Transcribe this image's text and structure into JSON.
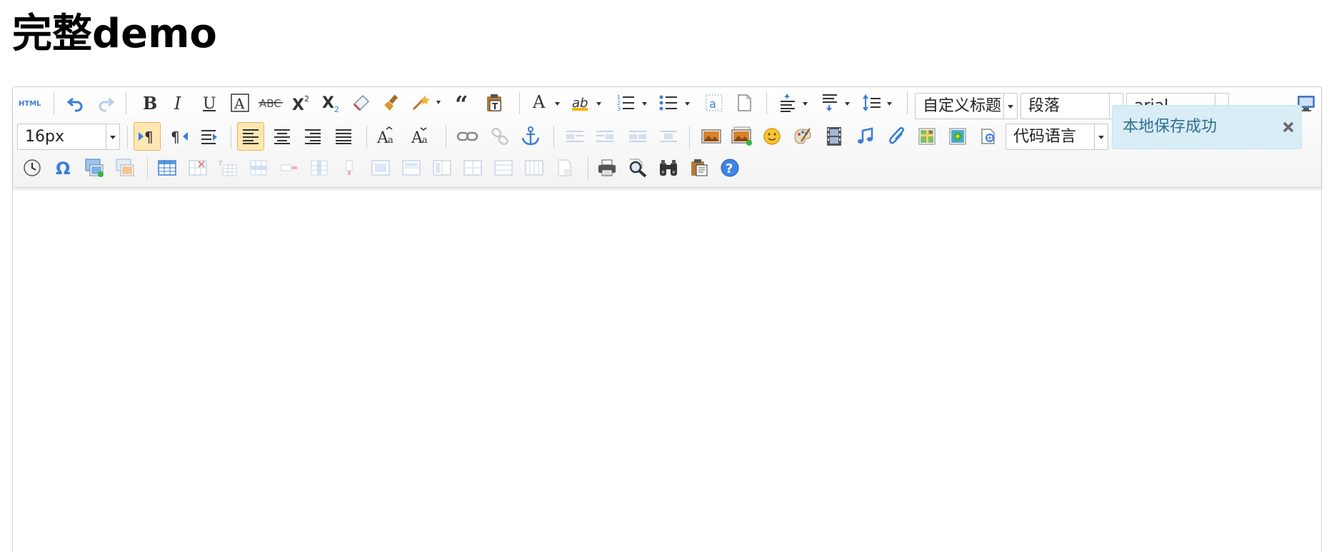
{
  "page": {
    "title": "完整demo"
  },
  "toolbar": {
    "font_size": "16px",
    "custom_heading": "自定义标题",
    "paragraph": "段落",
    "font_family": "arial",
    "code_language": "代码语言"
  },
  "notification": {
    "message": "本地保存成功"
  },
  "colors": {
    "accent": "#3b7dd8",
    "toast_bg": "#d9edf7",
    "toast_text": "#31708f",
    "active_bg": "#ffe7b3"
  },
  "icons": [
    "html-icon",
    "undo-icon",
    "redo-icon",
    "bold-icon",
    "italic-icon",
    "underline-icon",
    "font-border-icon",
    "strikethrough-icon",
    "superscript-icon",
    "subscript-icon",
    "remove-format-icon",
    "format-match-icon",
    "auto-typeset-icon",
    "blockquote-icon",
    "paste-plain-icon",
    "fore-color-icon",
    "back-color-icon",
    "ordered-list-icon",
    "unordered-list-icon",
    "select-all-icon",
    "clear-doc-icon",
    "row-spacing-top-icon",
    "row-spacing-bottom-icon",
    "line-height-icon",
    "fullscreen-icon",
    "direction-ltr-icon",
    "direction-rtl-icon",
    "indent-icon",
    "justify-left-icon",
    "justify-center-icon",
    "justify-right-icon",
    "justify-justify-icon",
    "to-uppercase-icon",
    "to-lowercase-icon",
    "link-icon",
    "unlink-icon",
    "anchor-icon",
    "image-none-icon",
    "image-left-icon",
    "image-right-icon",
    "image-center-icon",
    "simple-upload-icon",
    "insert-image-icon",
    "emotion-icon",
    "scrawl-icon",
    "insert-video-icon",
    "music-icon",
    "attachment-icon",
    "map-icon",
    "gmap-icon",
    "insert-frame-icon",
    "page-break-icon",
    "template-icon",
    "background-icon",
    "horizontal-rule-icon",
    "date-icon",
    "time-icon",
    "special-chars-icon",
    "word-image-icon",
    "table-icon"
  ]
}
